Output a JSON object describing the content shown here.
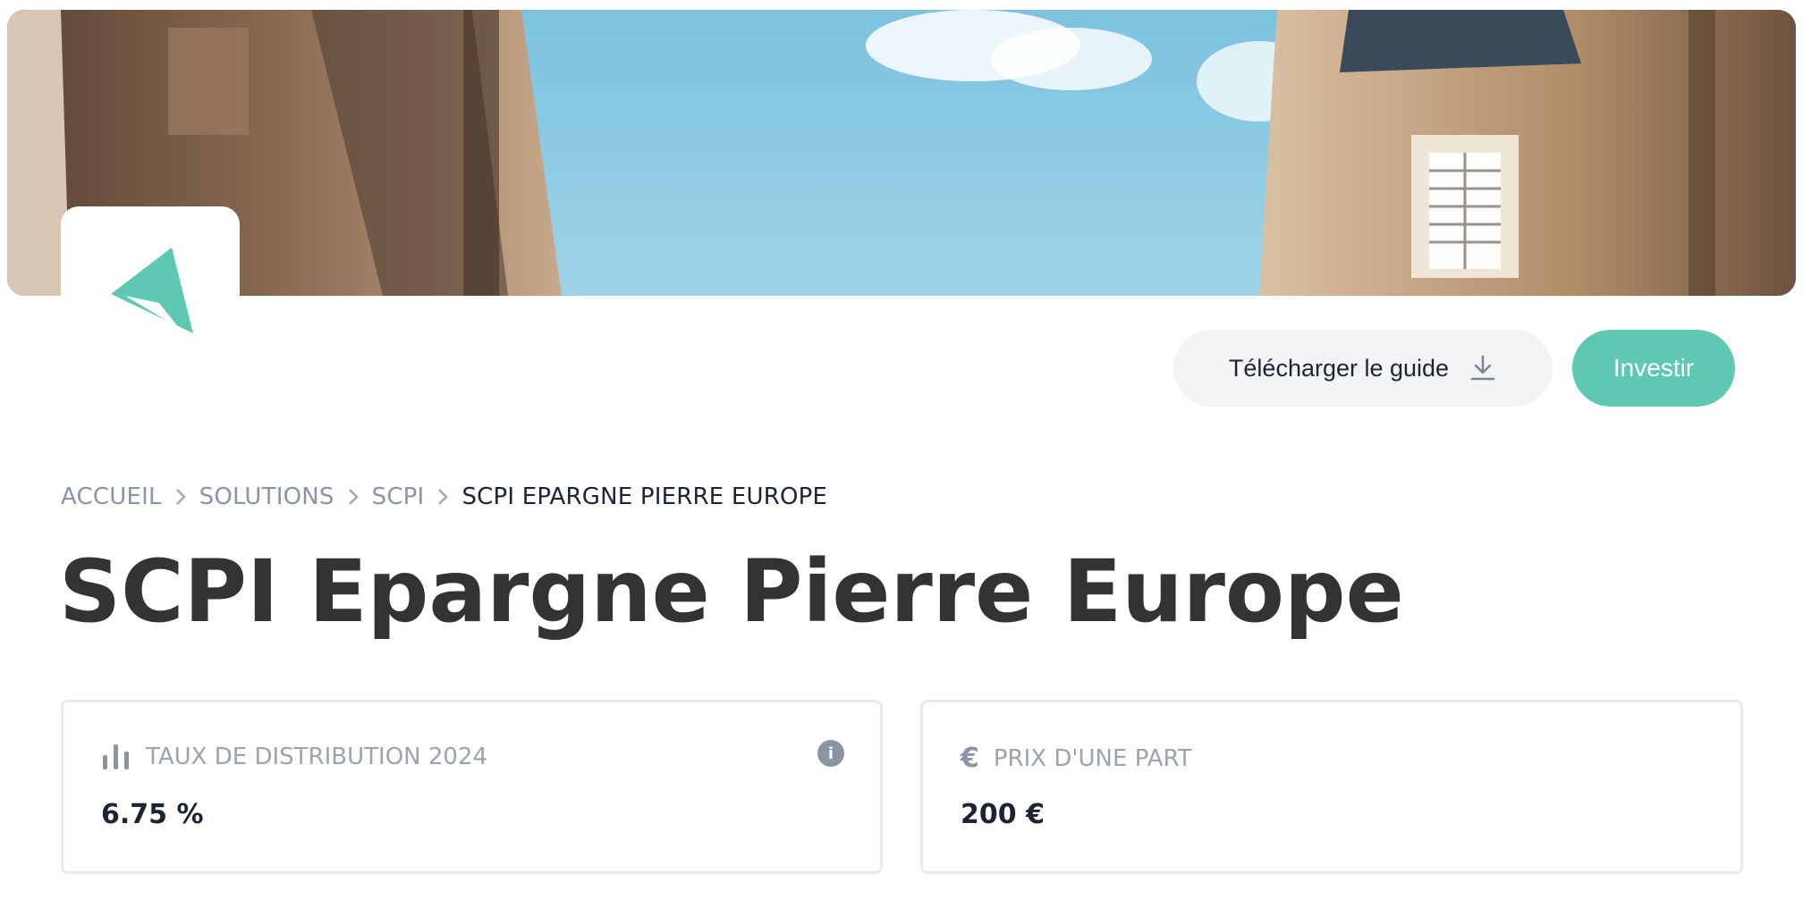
{
  "header": {
    "guide_button_label": "Télécharger le guide",
    "invest_button_label": "Investir"
  },
  "breadcrumb": {
    "items": [
      "ACCUEIL",
      "SOLUTIONS",
      "SCPI"
    ],
    "current": "SCPI EPARGNE PIERRE EUROPE"
  },
  "page_title": "SCPI Epargne Pierre Europe",
  "stats": {
    "distribution": {
      "label": "TAUX DE DISTRIBUTION 2024",
      "value": "6.75 %",
      "info_icon_text": "i",
      "icon": "bar-chart-icon"
    },
    "share_price": {
      "label": "PRIX D'UNE PART",
      "value": "200 €",
      "icon_glyph": "€",
      "icon": "euro-icon"
    }
  },
  "colors": {
    "accent": "#5ec8b3",
    "logo": "#5ec8b3",
    "text_dark": "#333333",
    "text_muted": "#9aa3ae",
    "button_secondary_bg": "#f2f4f6"
  }
}
